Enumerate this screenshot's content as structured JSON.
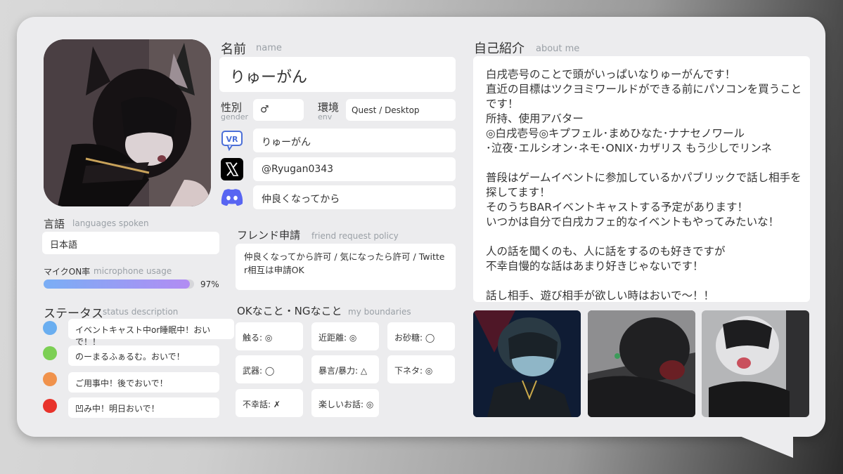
{
  "profile": {
    "name_label_jp": "名前",
    "name_label_en": "name",
    "name_value": "りゅーがん",
    "gender_label_jp": "性別",
    "gender_label_en": "gender",
    "gender_value": "♂",
    "env_label_jp": "環境",
    "env_label_en": "env",
    "env_value": "Quest / Desktop",
    "vrchat_icon": "vrchat-icon",
    "vrchat_value": "りゅーがん",
    "x_icon": "x-logo-icon",
    "x_value": "@Ryugan0343",
    "discord_icon": "discord-icon",
    "discord_value": "仲良くなってから"
  },
  "languages": {
    "label_jp": "言語",
    "label_en": "languages spoken",
    "value": "日本語"
  },
  "microphone": {
    "label_jp": "マイクON率",
    "label_en": "microphone usage",
    "percent_text": "97%",
    "fraction": 0.97
  },
  "status": {
    "label_jp": "ステータス",
    "label_en": "status description",
    "items": [
      {
        "color": "#6aaef0",
        "text": "イベントキャスト中or睡眠中！おいで！！"
      },
      {
        "color": "#7ccf54",
        "text": "のーまるふぁるむ。おいで！"
      },
      {
        "color": "#f0924c",
        "text": "ご用事中！後でおいで！"
      },
      {
        "color": "#e8322a",
        "text": "凹み中！明日おいで！"
      }
    ]
  },
  "friend_request": {
    "label_jp": "フレンド申請",
    "label_en": "friend request policy",
    "value": "仲良くなってから許可 / 気になったら許可 / Twitter相互は申請OK"
  },
  "boundaries": {
    "label_jp": "OKなこと・NGなこと",
    "label_en": "my boundaries",
    "items": [
      "触る: ◎",
      "近距離: ◎",
      "お砂糖: ◯",
      "武器: ◯",
      "暴言/暴力: △",
      "下ネタ: ◎",
      "不幸話: ✗",
      "楽しいお話: ◎"
    ]
  },
  "about": {
    "label_jp": "自己紹介",
    "label_en": "about me",
    "text": "白戌壱号のことで頭がいっぱいなりゅーがんです！\n直近の目標はツクヨミワールドができる前にパソコンを買うことです！\n所持、使用アバター\n◎白戌壱号◎キプフェル･まめひなた･ナナセノワール\n･泣夜･エルシオン･ネモ･ONIX･カザリス もう少しでリンネ\n\n普段はゲームイベントに参加しているかパブリックで話し相手を探してます！\nそのうちBARイベントキャストする予定があります！\nいつかは自分で白戌カフェ的なイベントもやってみたいな！\n\n人の話を聞くのも、人に話をするのも好きですが\n不幸自慢的な話はあまり好きじゃないです！\n\n話し相手、遊び相手が欲しい時はおいで〜！！"
  },
  "colors": {
    "card": "#ececee",
    "vrchat": "#4b6fd8",
    "discord": "#5865f2"
  }
}
